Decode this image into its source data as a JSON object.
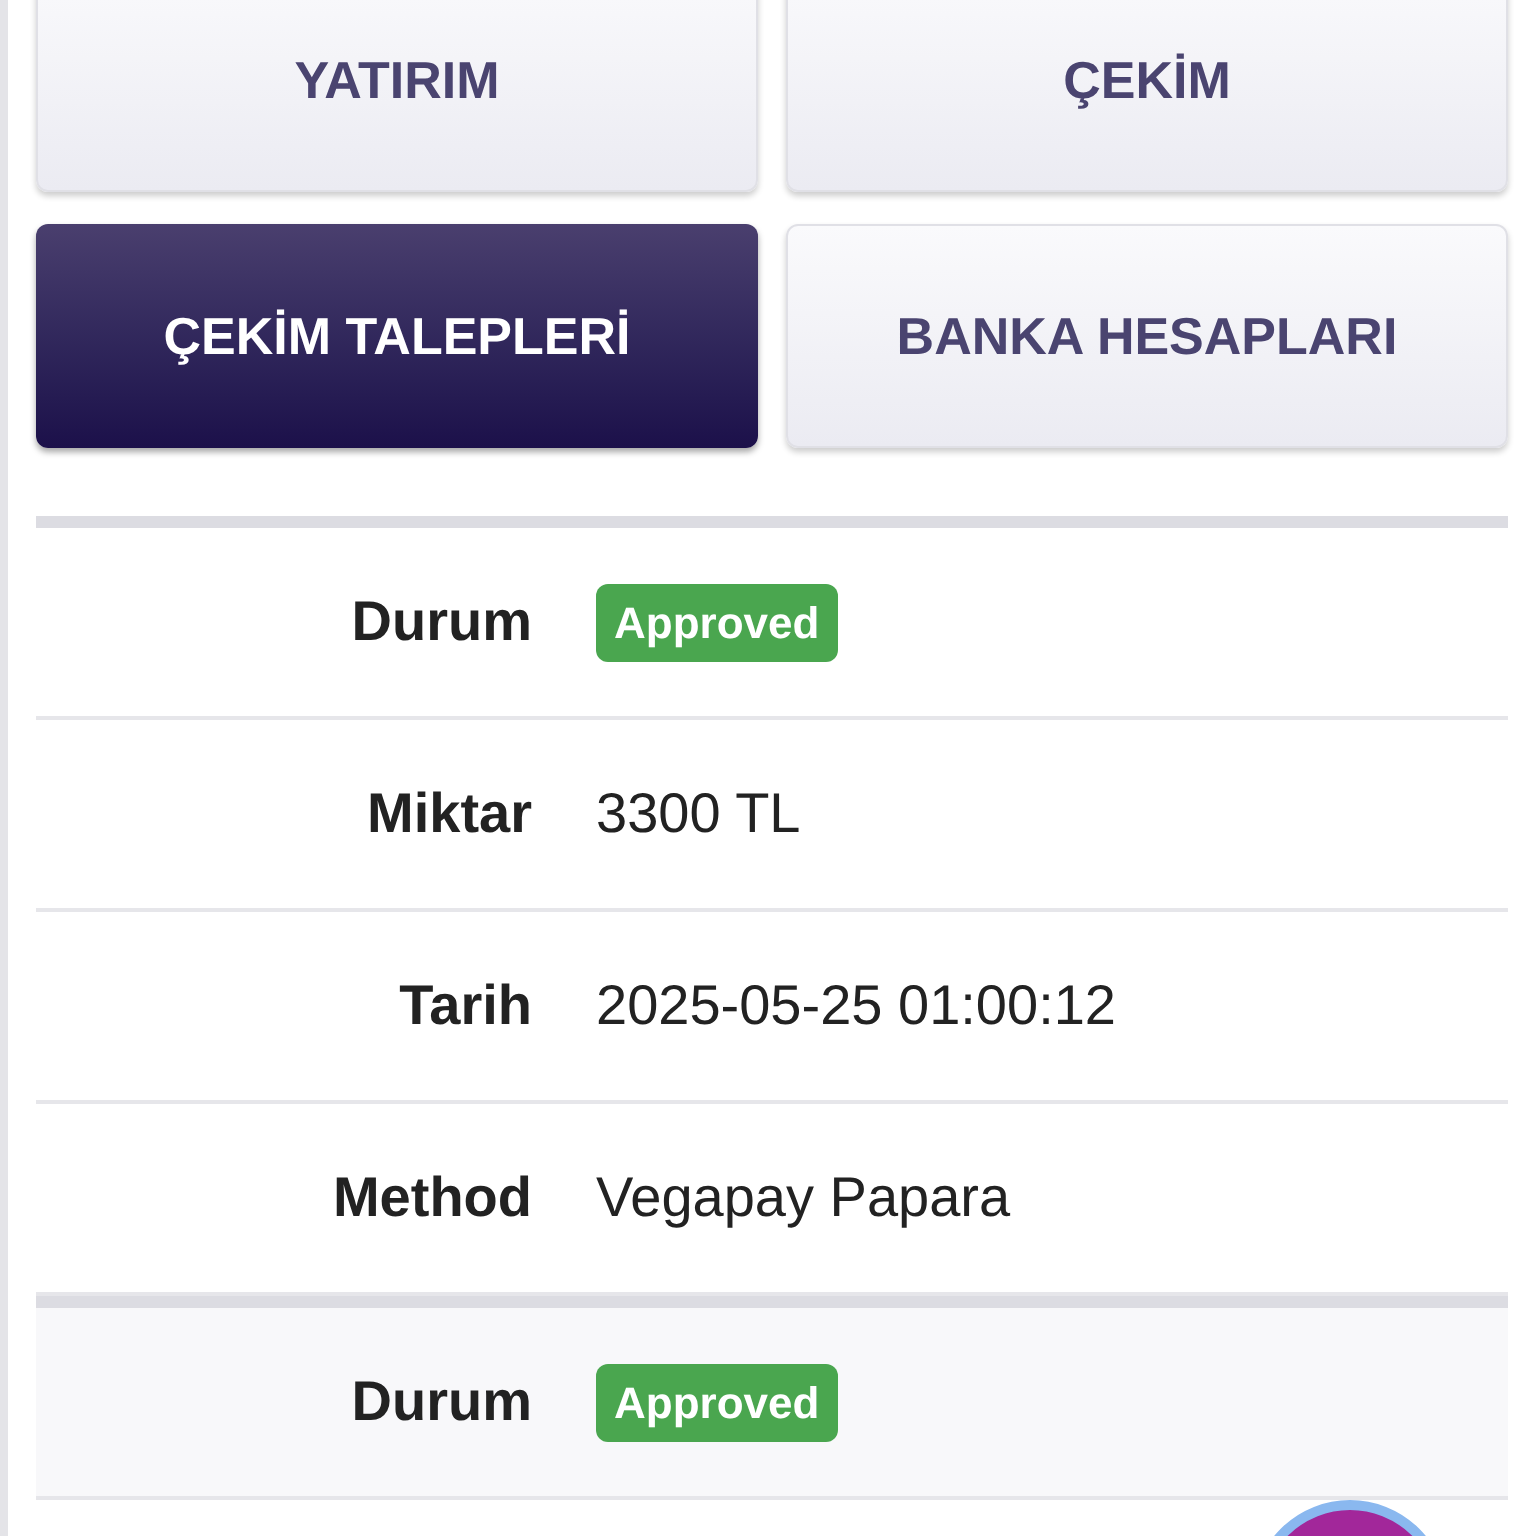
{
  "menu_buttons": [
    {
      "label": "YATIRIM",
      "selected": false
    },
    {
      "label": "ÇEKİM",
      "selected": false
    },
    {
      "label": "ÇEKİM TALEPLERİ",
      "selected": true
    },
    {
      "label": "BANKA HESAPLARI",
      "selected": false
    }
  ],
  "records": [
    {
      "fields": [
        {
          "label": "Durum",
          "kind": "status",
          "value": "Approved",
          "color": "#4aa64f"
        },
        {
          "label": "Miktar",
          "kind": "text",
          "value": "3300 TL"
        },
        {
          "label": "Tarih",
          "kind": "text",
          "value": "2025-05-25 01:00:12"
        },
        {
          "label": "Method",
          "kind": "text",
          "value": "Vegapay Papara"
        }
      ]
    },
    {
      "fields": [
        {
          "label": "Durum",
          "kind": "status",
          "value": "Approved",
          "color": "#4aa64f"
        }
      ]
    }
  ]
}
